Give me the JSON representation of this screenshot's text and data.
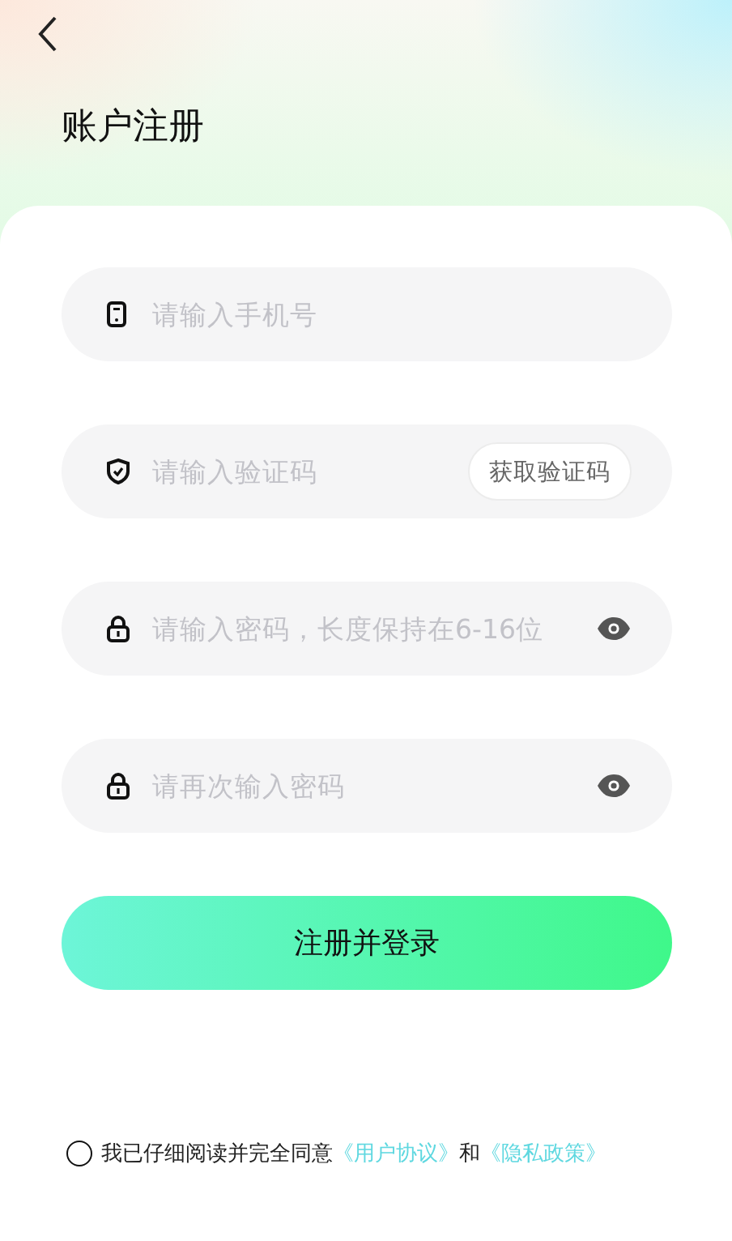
{
  "header": {
    "title": "账户注册"
  },
  "fields": [
    {
      "kind": "phone",
      "placeholder": "请输入手机号"
    },
    {
      "kind": "code",
      "placeholder": "请输入验证码",
      "action": "获取验证码"
    },
    {
      "kind": "password",
      "placeholder": "请输入密码，长度保持在6-16位"
    },
    {
      "kind": "password",
      "placeholder": "请再次输入密码"
    }
  ],
  "submit": "注册并登录",
  "agreement": {
    "checked": false,
    "text": "我已仔细阅读并完全同意",
    "link_1": "《用户协议》",
    "joiner": "和",
    "link_2": "《隐私政策》"
  }
}
